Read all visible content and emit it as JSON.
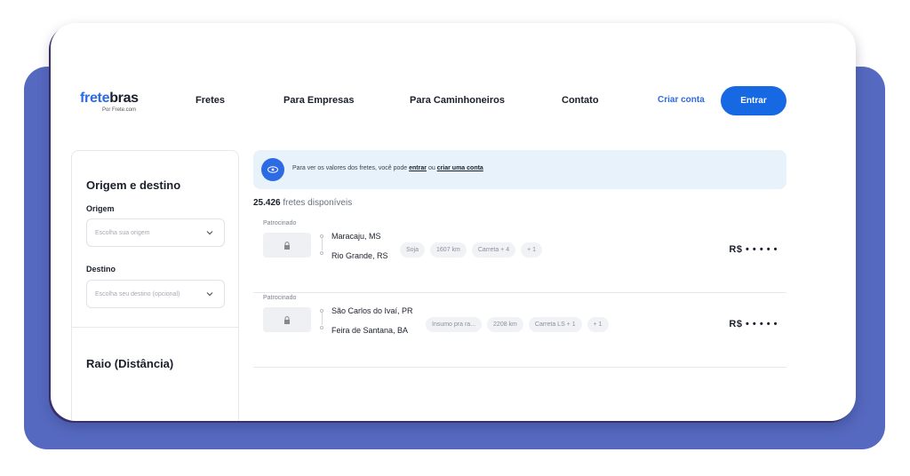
{
  "header": {
    "logo": {
      "part1": "frete",
      "part2": "bras",
      "sub": "Por Frete.com"
    },
    "nav": [
      "Fretes",
      "Para Empresas",
      "Para Caminhoneiros",
      "Contato"
    ],
    "criar_conta": "Criar conta",
    "entrar": "Entrar"
  },
  "sidebar": {
    "title": "Origem e destino",
    "origem_label": "Origem",
    "origem_placeholder": "Escolha sua origem",
    "destino_label": "Destino",
    "destino_placeholder": "Escolha seu destino (opcional)",
    "raio_title": "Raio (Distância)"
  },
  "banner": {
    "text_before": "Para ver os valores dos fretes, você pode",
    "link_entrar": "entrar",
    "text_mid": "ou",
    "link_criar": "criar uma conta"
  },
  "results": {
    "count": "25.426",
    "label": "fretes disponíveis"
  },
  "freights": [
    {
      "sponsored": "Patrocinado",
      "origin": "Maracaju, MS",
      "destination": "Rio Grande, RS",
      "chips": [
        "Soja",
        "1607 km",
        "Carreta + 4",
        "+ 1"
      ],
      "price": "R$ • • • • •"
    },
    {
      "sponsored": "Patrocinado",
      "origin": "São Carlos do Ivaí, PR",
      "destination": "Feira de Santana, BA",
      "chips": [
        "Insumo pra ra...",
        "2208 km",
        "Carreta LS + 1",
        "+ 1"
      ],
      "price": "R$ • • • • •"
    }
  ],
  "colors": {
    "accent": "#1668e3",
    "frame": "#5569c0",
    "banner_bg": "#e8f2fb"
  }
}
